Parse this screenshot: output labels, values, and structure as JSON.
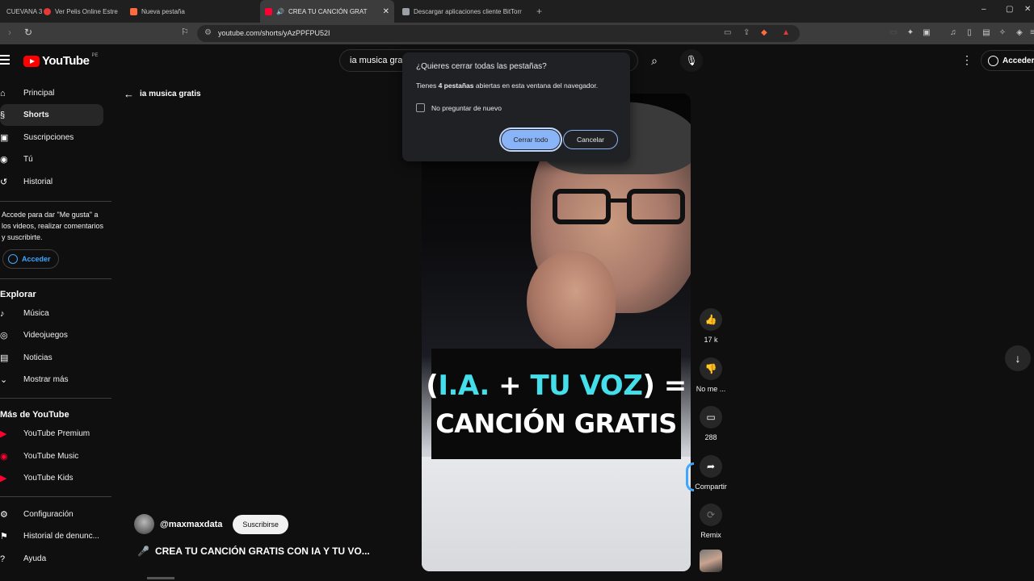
{
  "browser": {
    "tabs": [
      {
        "label": "CUEVANA 3",
        "fav_color": "#1f1f1f"
      },
      {
        "label": "Ver Pelis Online Estre",
        "fav_color": "#e53935"
      },
      {
        "label": "Nueva pestaña",
        "fav_color": "#ff6b3d"
      },
      {
        "label": "CREA TU CANCIÓN GRAT",
        "fav_color": "#ff0033"
      },
      {
        "label": "Descargar aplicaciones cliente BitTorr",
        "fav_color": "#9aa0a6"
      }
    ],
    "new_tab": "+",
    "url": "youtube.com/shorts/yAzPPFPU52I",
    "window": {
      "minimize": "–",
      "maximize": "▢",
      "close": "✕"
    }
  },
  "youtube": {
    "logo_word": "YouTube",
    "logo_country": "PE",
    "search_query": "ia musica gratis",
    "signin_label": "Acceder",
    "sidebar": {
      "main": [
        {
          "label": "Principal",
          "icon": "home-icon",
          "glyph": "⌂"
        },
        {
          "label": "Shorts",
          "icon": "shorts-icon",
          "glyph": "§"
        },
        {
          "label": "Suscripciones",
          "icon": "subscriptions-icon",
          "glyph": "▣"
        },
        {
          "label": "Tú",
          "icon": "you-icon",
          "glyph": "◉"
        },
        {
          "label": "Historial",
          "icon": "history-icon",
          "glyph": "↺"
        }
      ],
      "signin_message": "Accede para dar \"Me gusta\" a los videos, realizar comentarios y suscribirte.",
      "signin_button": "Acceder",
      "explore_title": "Explorar",
      "explore": [
        {
          "label": "Música",
          "icon": "music-icon",
          "glyph": "♪"
        },
        {
          "label": "Videojuegos",
          "icon": "gaming-icon",
          "glyph": "◎"
        },
        {
          "label": "Noticias",
          "icon": "news-icon",
          "glyph": "▤"
        },
        {
          "label": "Mostrar más",
          "icon": "chevron-down-icon",
          "glyph": "⌄"
        }
      ],
      "more_title": "Más de YouTube",
      "more": [
        {
          "label": "YouTube Premium",
          "icon": "youtube-premium-icon",
          "glyph": "▶"
        },
        {
          "label": "YouTube Music",
          "icon": "youtube-music-icon",
          "glyph": "◉"
        },
        {
          "label": "YouTube Kids",
          "icon": "youtube-kids-icon",
          "glyph": "▶"
        }
      ],
      "footer": [
        {
          "label": "Configuración",
          "icon": "gear-icon",
          "glyph": "⚙"
        },
        {
          "label": "Historial de denunc...",
          "icon": "flag-icon",
          "glyph": "⚑"
        },
        {
          "label": "Ayuda",
          "icon": "help-icon",
          "glyph": "?"
        }
      ]
    },
    "back_label": "ia musica gratis",
    "video": {
      "caption_open": "(",
      "caption_cyan": "I.A.",
      "caption_plus": " + ",
      "caption_cyan2": "TU VOZ",
      "caption_close": ") =",
      "caption_line2": "CANCIÓN GRATIS"
    },
    "actions": [
      {
        "label": "17 k",
        "icon": "like-icon",
        "glyph": "👍"
      },
      {
        "label": "No me ...",
        "icon": "dislike-icon",
        "glyph": "👎"
      },
      {
        "label": "288",
        "icon": "comment-icon",
        "glyph": "▭"
      },
      {
        "label": "Compartir",
        "icon": "share-icon",
        "glyph": "➦"
      },
      {
        "label": "Remix",
        "icon": "remix-icon",
        "glyph": "⟳"
      }
    ],
    "channel_handle": "@maxmaxdata",
    "subscribe_label": "Suscribirse",
    "video_title": "CREA TU CANCIÓN GRATIS CON IA Y TU VO...",
    "title_emoji": "🎤"
  },
  "dialog": {
    "title": "¿Quieres cerrar todas las pestañas?",
    "msg_before": "Tienes ",
    "msg_count": "4 pestañas",
    "msg_after": " abiertas en esta ventana del navegador.",
    "checkbox_label": "No preguntar de nuevo",
    "confirm_label": "Cerrar todo",
    "cancel_label": "Cancelar",
    "accent": "#8ab4f8"
  }
}
